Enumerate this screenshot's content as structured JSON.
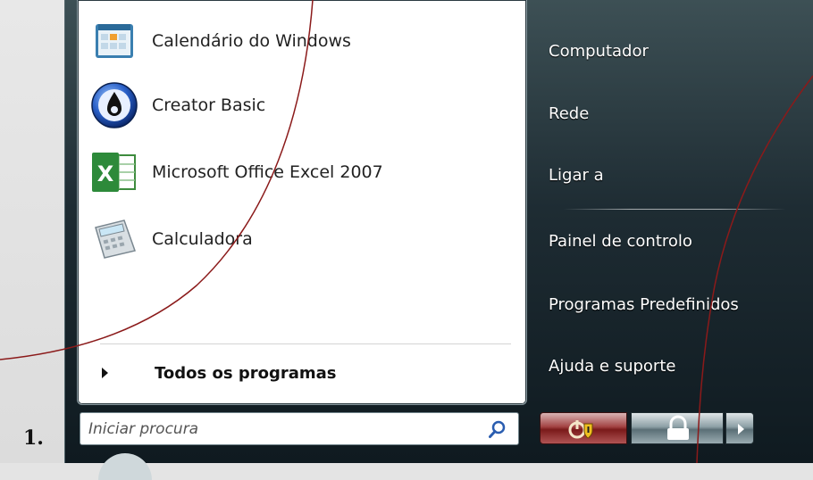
{
  "step_label": "1.",
  "programs": [
    {
      "label": "Calendário do Windows",
      "icon": "calendar-icon"
    },
    {
      "label": "Creator Basic",
      "icon": "creator-disc-icon"
    },
    {
      "label": "Microsoft Office Excel 2007",
      "icon": "excel-icon"
    },
    {
      "label": "Calculadora",
      "icon": "calculator-icon"
    }
  ],
  "all_programs": {
    "label": "Todos os programas",
    "icon": "triangle-right-icon"
  },
  "search": {
    "placeholder": "Iniciar procura",
    "icon": "magnifier-icon"
  },
  "right_items": [
    {
      "label": "Computador"
    },
    {
      "label": "Rede"
    },
    {
      "label": "Ligar a"
    },
    {
      "label": "Painel de controlo"
    },
    {
      "label": "Programas Predefinidos"
    },
    {
      "label": "Ajuda e suporte"
    }
  ],
  "power_buttons": {
    "sleep_icon": "power-shield-icon",
    "lock_icon": "padlock-icon",
    "more_icon": "triangle-right-icon"
  },
  "colors": {
    "annotation_line": "#8b1a1a",
    "menu_dark": "#1e2c33",
    "power_red": "#a34343"
  }
}
